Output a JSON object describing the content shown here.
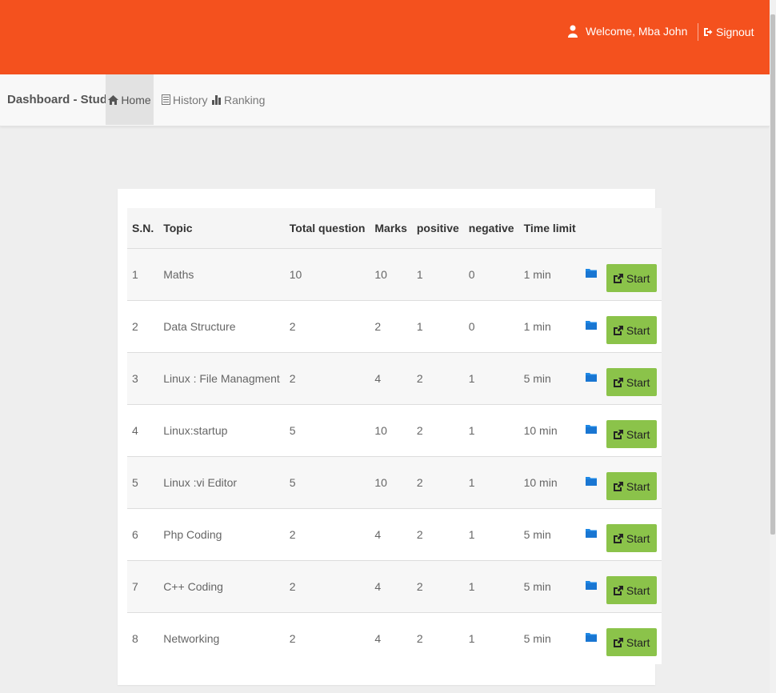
{
  "header": {
    "welcome_text": "Welcome,  Mba John",
    "signout_label": "Signout",
    "bg_color": "#f4511e"
  },
  "navbar": {
    "brand": "Dashboard - Student",
    "items": [
      {
        "label": "Home",
        "icon": "home-icon",
        "active": true
      },
      {
        "label": "History",
        "icon": "list-icon",
        "active": false
      },
      {
        "label": "Ranking",
        "icon": "bar-chart-icon",
        "active": false
      }
    ]
  },
  "table": {
    "headers": [
      "S.N.",
      "Topic",
      "Total question",
      "Marks",
      "positive",
      "negative",
      "Time limit"
    ],
    "start_label": "Start",
    "start_color": "#8bc34a",
    "folder_color": "#1e88e5",
    "rows": [
      {
        "sn": "1",
        "topic": "Maths",
        "total": "10",
        "marks": "10",
        "positive": "1",
        "negative": "0",
        "time": "1 min"
      },
      {
        "sn": "2",
        "topic": "Data Structure",
        "total": "2",
        "marks": "2",
        "positive": "1",
        "negative": "0",
        "time": "1 min"
      },
      {
        "sn": "3",
        "topic": "Linux : File Managment",
        "total": "2",
        "marks": "4",
        "positive": "2",
        "negative": "1",
        "time": "5 min"
      },
      {
        "sn": "4",
        "topic": "Linux:startup",
        "total": "5",
        "marks": "10",
        "positive": "2",
        "negative": "1",
        "time": "10 min"
      },
      {
        "sn": "5",
        "topic": "Linux :vi Editor",
        "total": "5",
        "marks": "10",
        "positive": "2",
        "negative": "1",
        "time": "10 min"
      },
      {
        "sn": "6",
        "topic": "Php Coding",
        "total": "2",
        "marks": "4",
        "positive": "2",
        "negative": "1",
        "time": "5 min"
      },
      {
        "sn": "7",
        "topic": "C++ Coding",
        "total": "2",
        "marks": "4",
        "positive": "2",
        "negative": "1",
        "time": "5 min"
      },
      {
        "sn": "8",
        "topic": "Networking",
        "total": "2",
        "marks": "4",
        "positive": "2",
        "negative": "1",
        "time": "5 min"
      }
    ]
  }
}
